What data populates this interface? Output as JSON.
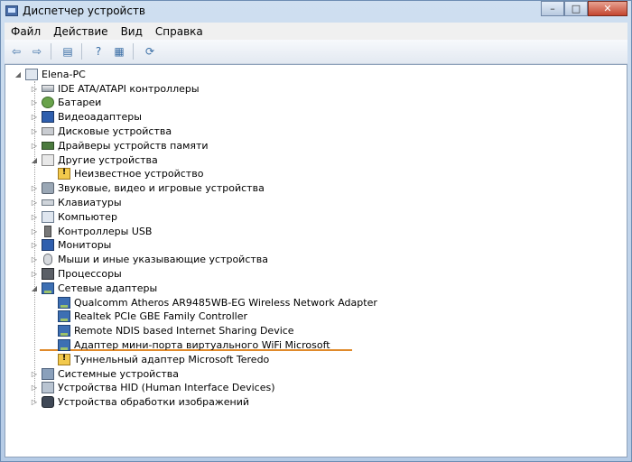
{
  "window": {
    "title": "Диспетчер устройств"
  },
  "caption_buttons": {
    "minimize": "–",
    "maximize": "□",
    "close": "✕"
  },
  "menu": [
    "Файл",
    "Действие",
    "Вид",
    "Справка"
  ],
  "toolbar": [
    {
      "icon": "back-arrow-icon",
      "glyph": "⇦"
    },
    {
      "icon": "forward-arrow-icon",
      "glyph": "⇨"
    },
    {
      "icon": "properties-icon",
      "glyph": "▤"
    },
    {
      "icon": "help-icon",
      "glyph": "?"
    },
    {
      "icon": "view-icon",
      "glyph": "▦"
    },
    {
      "icon": "scan-hardware-icon",
      "glyph": "⟳"
    }
  ],
  "tree": {
    "root": "Elena-PC",
    "items": [
      {
        "label": "IDE ATA/ATAPI контроллеры",
        "icon": "ide-controller-icon",
        "cls": "i-drive",
        "level": 1,
        "expander": "▷"
      },
      {
        "label": "Батареи",
        "icon": "battery-icon",
        "cls": "i-bat",
        "level": 1,
        "expander": "▷"
      },
      {
        "label": "Видеоадаптеры",
        "icon": "display-adapter-icon",
        "cls": "i-mon",
        "level": 1,
        "expander": "▷"
      },
      {
        "label": "Дисковые устройства",
        "icon": "disk-drive-icon",
        "cls": "i-disk",
        "level": 1,
        "expander": "▷"
      },
      {
        "label": "Драйверы устройств памяти",
        "icon": "memory-device-icon",
        "cls": "i-mem",
        "level": 1,
        "expander": "▷"
      },
      {
        "label": "Другие устройства",
        "icon": "other-devices-icon",
        "cls": "i-unk",
        "level": 1,
        "expander": "◢"
      },
      {
        "label": "Неизвестное устройство",
        "icon": "unknown-device-warning-icon",
        "cls": "i-warn",
        "level": 2,
        "expander": ""
      },
      {
        "label": "Звуковые, видео и игровые устройства",
        "icon": "sound-device-icon",
        "cls": "i-snd",
        "level": 1,
        "expander": "▷"
      },
      {
        "label": "Клавиатуры",
        "icon": "keyboard-icon",
        "cls": "i-kbd",
        "level": 1,
        "expander": "▷"
      },
      {
        "label": "Компьютер",
        "icon": "computer-icon",
        "cls": "i-pc",
        "level": 1,
        "expander": "▷"
      },
      {
        "label": "Контроллеры USB",
        "icon": "usb-controller-icon",
        "cls": "i-usb",
        "level": 1,
        "expander": "▷"
      },
      {
        "label": "Мониторы",
        "icon": "monitor-icon",
        "cls": "i-mon",
        "level": 1,
        "expander": "▷"
      },
      {
        "label": "Мыши и иные указывающие устройства",
        "icon": "mouse-icon",
        "cls": "i-mouse",
        "level": 1,
        "expander": "▷"
      },
      {
        "label": "Процессоры",
        "icon": "processor-icon",
        "cls": "i-cpu",
        "level": 1,
        "expander": "▷"
      },
      {
        "label": "Сетевые адаптеры",
        "icon": "network-adapter-icon",
        "cls": "i-net",
        "level": 1,
        "expander": "◢"
      },
      {
        "label": "Qualcomm Atheros AR9485WB-EG Wireless Network Adapter",
        "icon": "network-adapter-icon",
        "cls": "i-net",
        "level": 2,
        "expander": ""
      },
      {
        "label": "Realtek PCIe GBE Family Controller",
        "icon": "network-adapter-icon",
        "cls": "i-net",
        "level": 2,
        "expander": ""
      },
      {
        "label": "Remote NDIS based Internet Sharing Device",
        "icon": "network-adapter-icon",
        "cls": "i-net",
        "level": 2,
        "expander": ""
      },
      {
        "label": "Адаптер мини-порта виртуального WiFi Microsoft",
        "icon": "network-adapter-icon",
        "cls": "i-net",
        "level": 2,
        "expander": ""
      },
      {
        "label": "Туннельный адаптер Microsoft Teredo",
        "icon": "network-adapter-warning-icon",
        "cls": "i-warn",
        "level": 2,
        "expander": ""
      },
      {
        "label": "Системные устройства",
        "icon": "system-device-icon",
        "cls": "i-sys",
        "level": 1,
        "expander": "▷"
      },
      {
        "label": "Устройства HID (Human Interface Devices)",
        "icon": "hid-device-icon",
        "cls": "i-hid",
        "level": 1,
        "expander": "▷"
      },
      {
        "label": "Устройства обработки изображений",
        "icon": "imaging-device-icon",
        "cls": "i-cam",
        "level": 1,
        "expander": "▷"
      }
    ]
  },
  "colors": {
    "highlight_underline": "#e08a2b",
    "frame": "#b5cbe6"
  }
}
